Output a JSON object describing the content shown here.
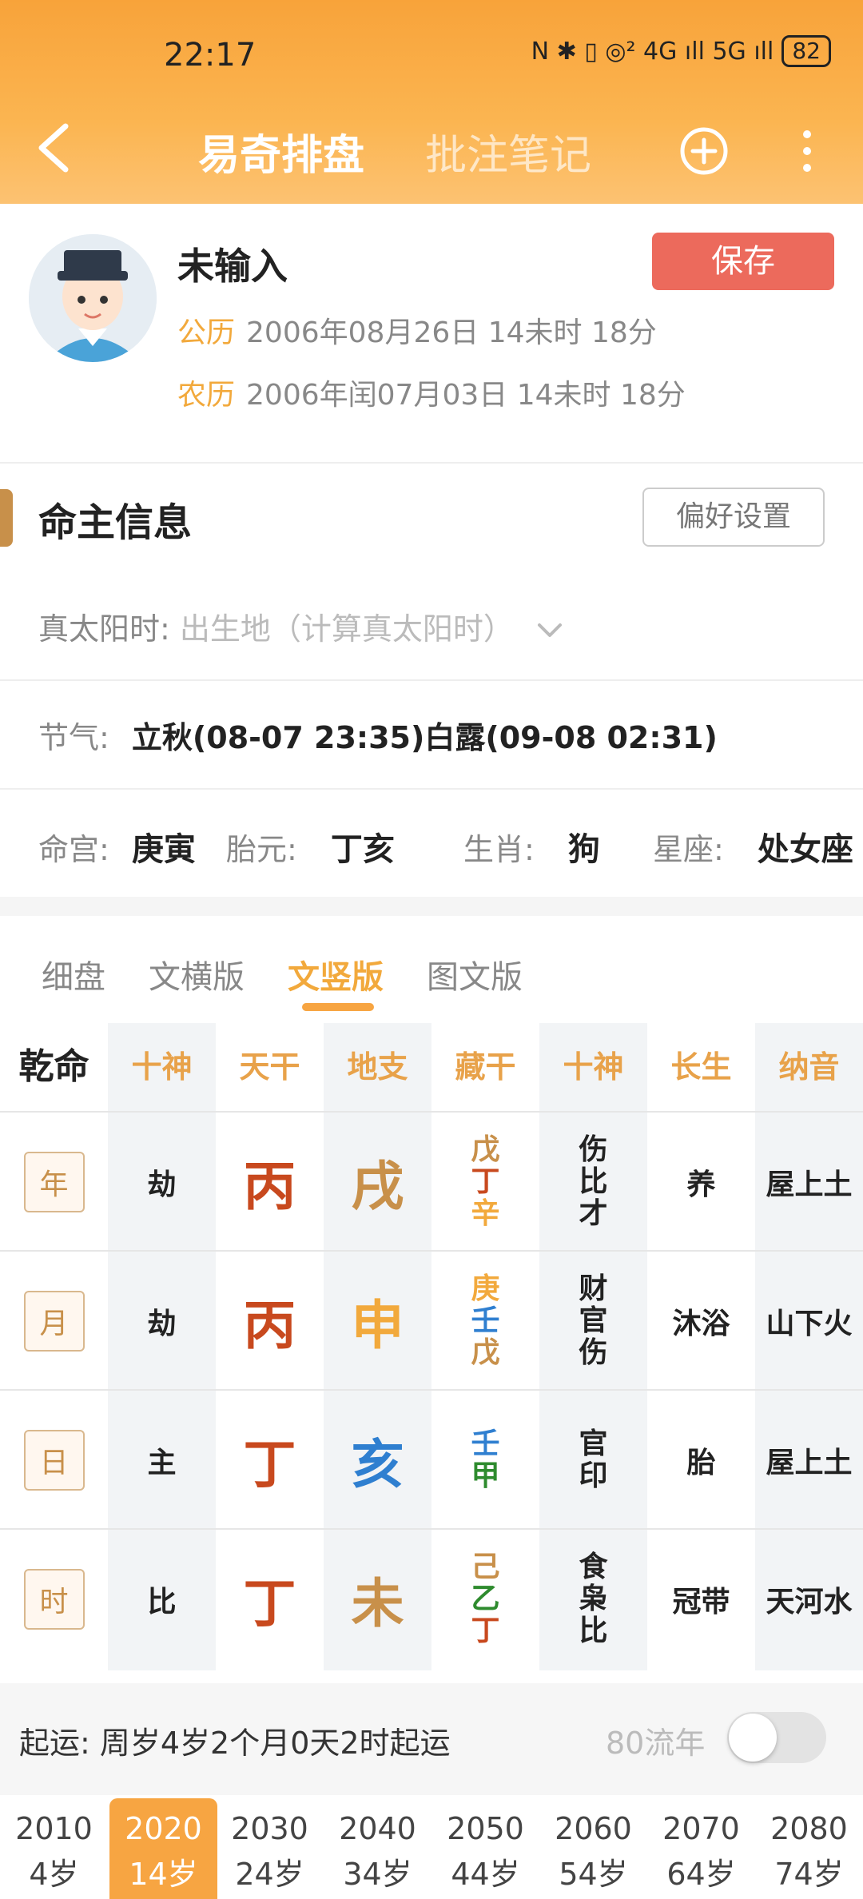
{
  "status_bar": {
    "time": "22:17",
    "signal_text": "N ✱ ▯ ◎² 4G ıll 5G ıll",
    "battery": "82"
  },
  "nav": {
    "tab_active": "易奇排盘",
    "tab_inactive": "批注笔记"
  },
  "profile": {
    "name": "未输入",
    "save_label": "保存",
    "solar_label": "公历",
    "solar_value": "2006年08月26日 14未时 18分",
    "lunar_label": "农历",
    "lunar_value": "2006年闰07月03日 14未时 18分"
  },
  "info": {
    "title": "命主信息",
    "pref_button": "偏好设置",
    "true_solar_label": "真太阳时:",
    "true_solar_placeholder": "出生地（计算真太阳时）",
    "jieqi_label": "节气:",
    "jieqi_value": "立秋(08-07 23:35)白露(09-08 02:31)",
    "minggong_label": "命宫:",
    "minggong_value": "庚寅",
    "taiyuan_label": "胎元:",
    "taiyuan_value": "丁亥",
    "shengxiao_label": "生肖:",
    "shengxiao_value": "狗",
    "xingzuo_label": "星座:",
    "xingzuo_value": "处女座"
  },
  "view_tabs": [
    "细盘",
    "文横版",
    "文竖版",
    "图文版"
  ],
  "grid": {
    "headers": [
      "乾命",
      "十神",
      "天干",
      "地支",
      "藏干",
      "十神",
      "长生",
      "纳音"
    ],
    "rows": [
      {
        "pillar": "年",
        "shishen": "劫",
        "gan": "丙",
        "zhi": "戌",
        "zanggan": [
          "戊",
          "丁",
          "辛"
        ],
        "shishen2": [
          "伤",
          "比",
          "才"
        ],
        "changsheng": "养",
        "nayin": "屋上土"
      },
      {
        "pillar": "月",
        "shishen": "劫",
        "gan": "丙",
        "zhi": "申",
        "zanggan": [
          "庚",
          "壬",
          "戊"
        ],
        "shishen2": [
          "财",
          "官",
          "伤"
        ],
        "changsheng": "沐浴",
        "nayin": "山下火"
      },
      {
        "pillar": "日",
        "shishen": "主",
        "gan": "丁",
        "zhi": "亥",
        "zanggan": [
          "壬",
          "甲"
        ],
        "shishen2": [
          "官",
          "印"
        ],
        "changsheng": "胎",
        "nayin": "屋上土"
      },
      {
        "pillar": "时",
        "shishen": "比",
        "gan": "丁",
        "zhi": "未",
        "zanggan": [
          "己",
          "乙",
          "丁"
        ],
        "shishen2": [
          "食",
          "枭",
          "比"
        ],
        "changsheng": "冠带",
        "nayin": "天河水"
      }
    ]
  },
  "qiyun": {
    "text": "起运:  周岁4岁2个月0天2时起运",
    "liunian_label": "80流年"
  },
  "dayun": [
    {
      "year": "2010",
      "age": "4岁"
    },
    {
      "year": "2020",
      "age": "14岁"
    },
    {
      "year": "2030",
      "age": "24岁"
    },
    {
      "year": "2040",
      "age": "34岁"
    },
    {
      "year": "2050",
      "age": "44岁"
    },
    {
      "year": "2060",
      "age": "54岁"
    },
    {
      "year": "2070",
      "age": "64岁"
    },
    {
      "year": "2080",
      "age": "74岁"
    }
  ],
  "colors": {
    "accent": "#f7a542",
    "save": "#ec6a5c",
    "fire": "#c8491e",
    "earth": "#c8904a",
    "metal": "#f2a93c",
    "water": "#2f7fd0",
    "wood": "#2e8b2e"
  }
}
